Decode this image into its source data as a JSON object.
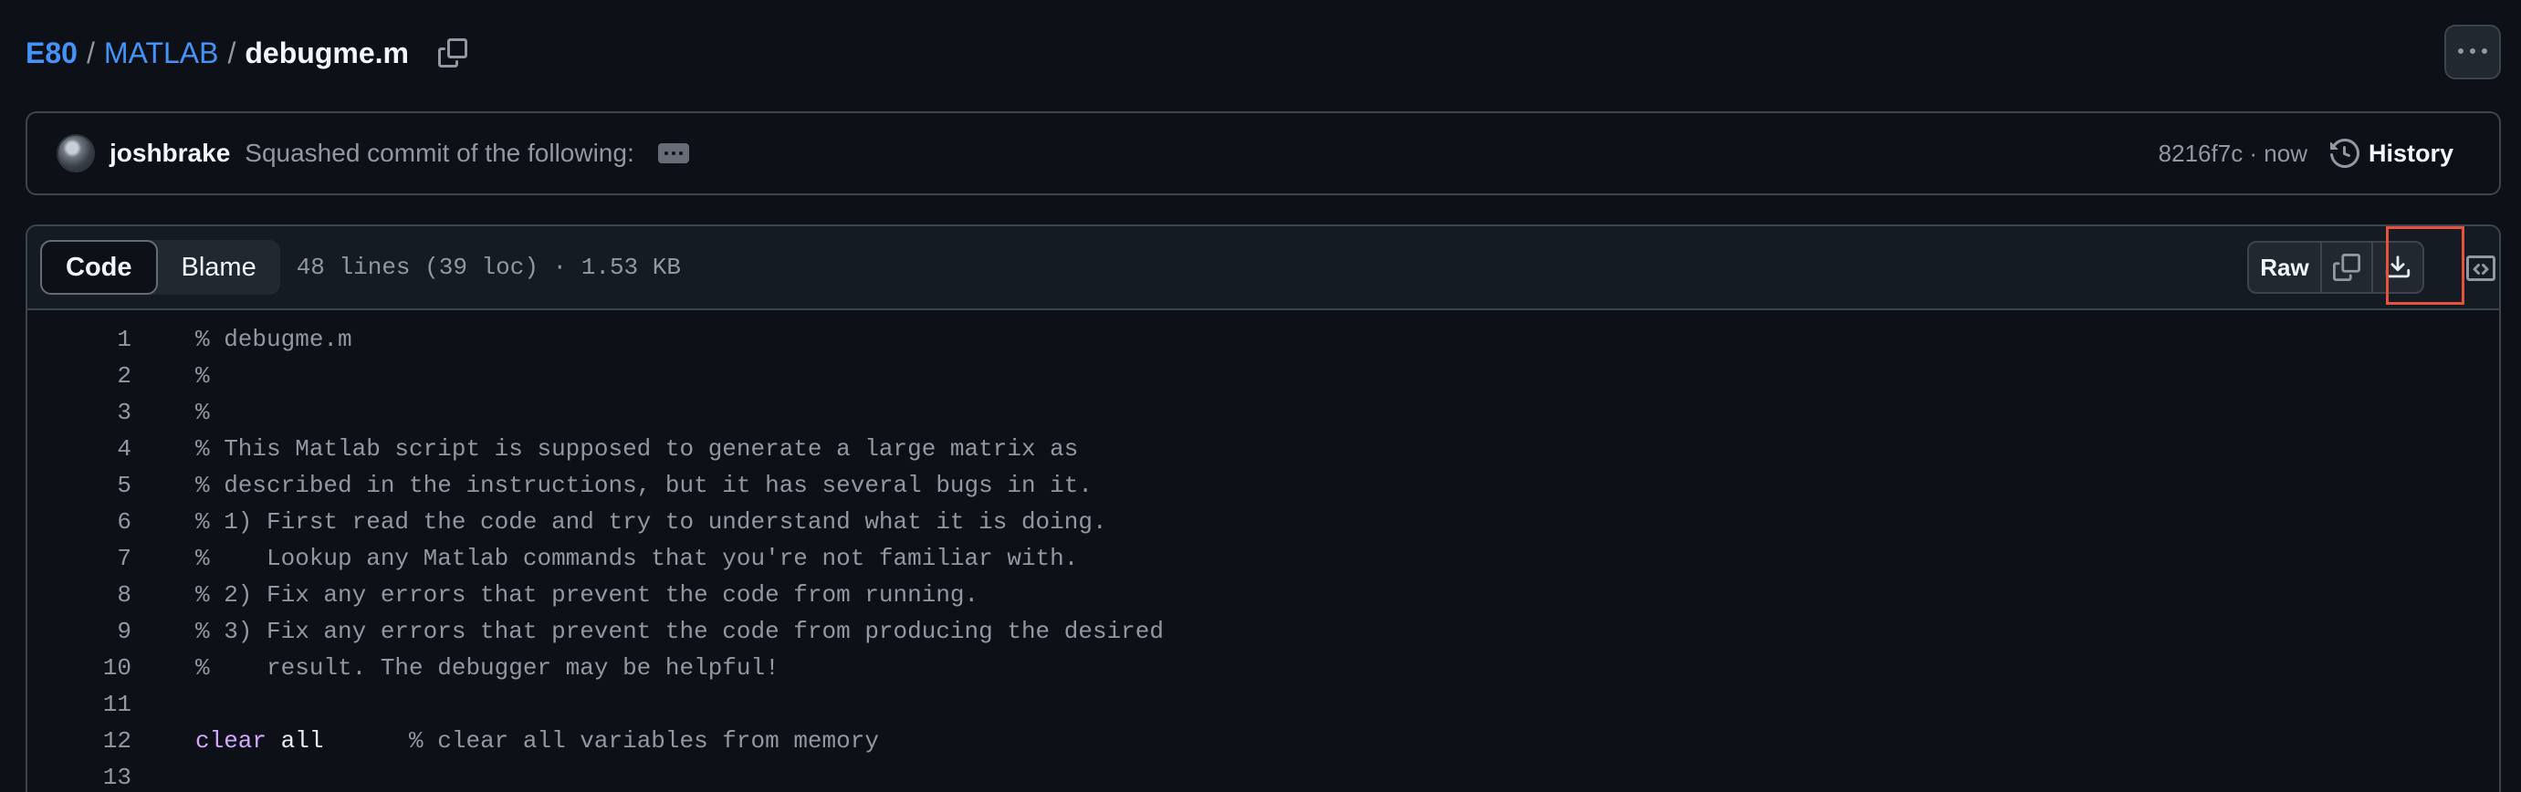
{
  "breadcrumb": {
    "owner": "E80",
    "repo": "MATLAB",
    "file": "debugme.m",
    "separator": "/"
  },
  "commit": {
    "author": "joshbrake",
    "message": "Squashed commit of the following:",
    "meta": "8216f7c · now",
    "history_label": "History"
  },
  "file_header": {
    "tabs": [
      "Code",
      "Blame"
    ],
    "active_tab": "Code",
    "info": "48 lines (39 loc) · 1.53 KB",
    "raw_label": "Raw"
  },
  "code": {
    "lines": [
      {
        "n": "1",
        "text": "% debugme.m"
      },
      {
        "n": "2",
        "text": "%"
      },
      {
        "n": "3",
        "text": "%"
      },
      {
        "n": "4",
        "text": "% This Matlab script is supposed to generate a large matrix as"
      },
      {
        "n": "5",
        "text": "% described in the instructions, but it has several bugs in it."
      },
      {
        "n": "6",
        "text": "% 1) First read the code and try to understand what it is doing."
      },
      {
        "n": "7",
        "text": "%    Lookup any Matlab commands that you're not familiar with."
      },
      {
        "n": "8",
        "text": "% 2) Fix any errors that prevent the code from running."
      },
      {
        "n": "9",
        "text": "% 3) Fix any errors that prevent the code from producing the desired"
      },
      {
        "n": "10",
        "text": "%    result. The debugger may be helpful!"
      },
      {
        "n": "11",
        "text": ""
      },
      {
        "n": "12",
        "kw": "clear",
        "kw2": "all",
        "text": "      % clear all variables from memory"
      },
      {
        "n": "13",
        "text": ""
      }
    ]
  },
  "colors": {
    "background": "#0d1117",
    "link": "#4493f8",
    "keyword": "#d2a8ff",
    "highlight_box": "#e5533d"
  },
  "icons": [
    "copy-icon",
    "kebab-horizontal-icon",
    "ellipsis-icon",
    "history-icon",
    "download-icon",
    "symbols-icon"
  ]
}
